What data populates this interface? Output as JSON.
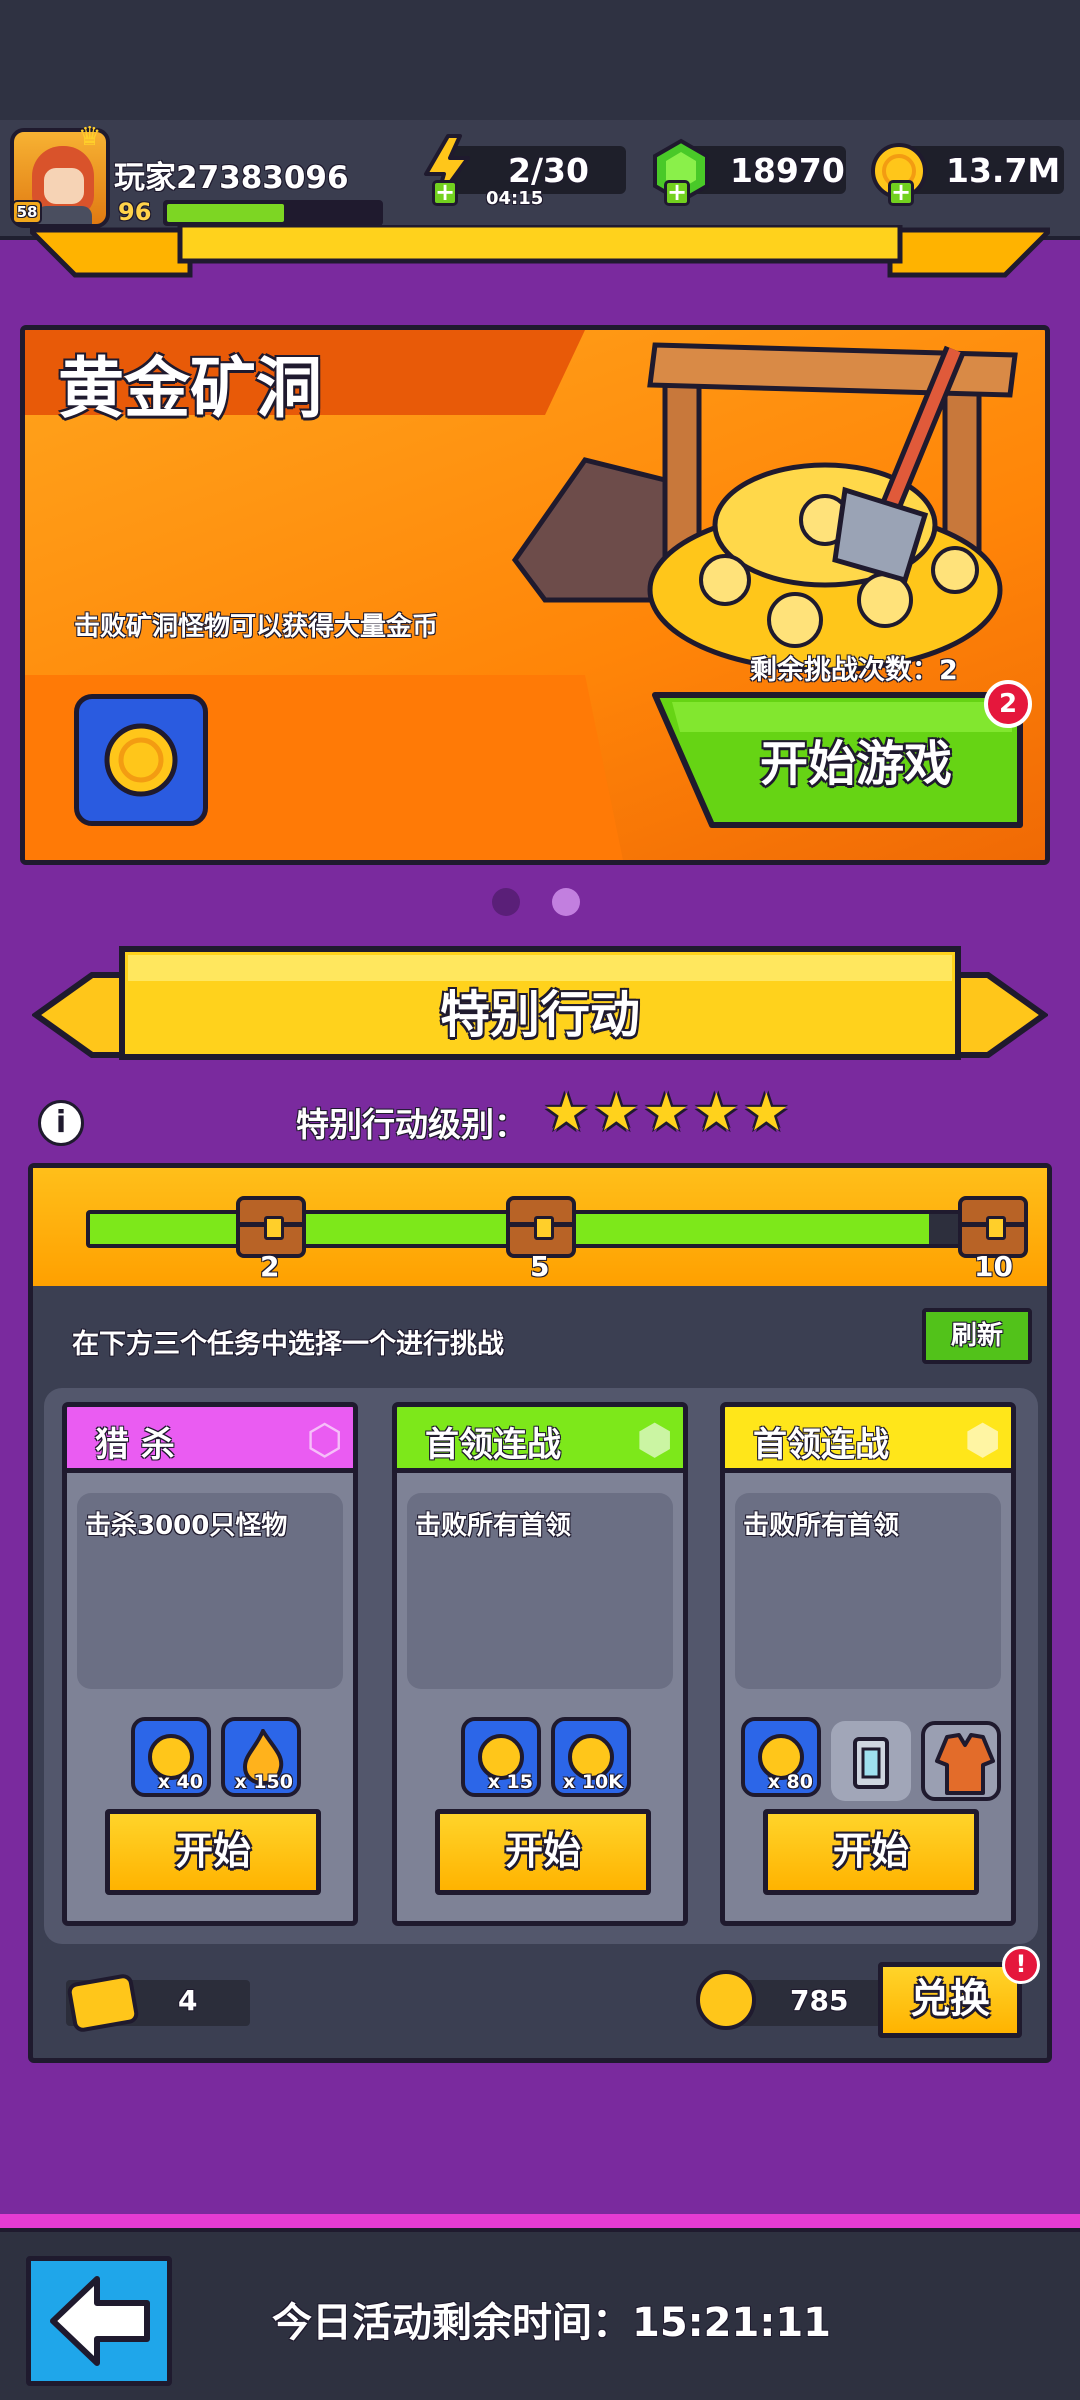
{
  "colors": {
    "background": "#7a2a9e",
    "accent_yellow": "#ffc61a",
    "accent_green": "#7de81a",
    "alert_red": "#e5173c"
  },
  "header": {
    "player_name": "玩家27383096",
    "player_level": "58",
    "xp_value": "96",
    "xp_progress_fraction": 0.55,
    "energy": "2/30",
    "energy_timer": "04:15",
    "gems": "18970",
    "gold": "13.7M"
  },
  "event": {
    "title": "黄金矿洞",
    "description": "击败矿洞怪物可以获得大量金币",
    "remaining_label": "剩余挑战次数：2",
    "start_button": "开始游戏",
    "badge_count": "2",
    "page_indicator": {
      "count": 2,
      "active_index": 1
    }
  },
  "special_action": {
    "title": "特别行动",
    "level_label": "特别行动级别：",
    "stars": 5,
    "progress_fraction": 0.9,
    "milestones": [
      "2",
      "5",
      "10"
    ],
    "task_instruction": "在下方三个任务中选择一个进行挑战",
    "refresh_button": "刷新",
    "cards": [
      {
        "title": "猎 杀",
        "head_color": "#ea5cf2",
        "description": "击杀3000只怪物",
        "rewards": [
          {
            "icon": "gold-token-icon",
            "qty": "x 40"
          },
          {
            "icon": "fire-orb-icon",
            "qty": "x 150"
          }
        ],
        "start_button": "开始"
      },
      {
        "title": "首领连战",
        "head_color": "#7de81a",
        "description": "击败所有首领",
        "rewards": [
          {
            "icon": "gold-token-icon",
            "qty": "x 15"
          },
          {
            "icon": "gold-coin-icon",
            "qty": "x 10K"
          }
        ],
        "start_button": "开始"
      },
      {
        "title": "首领连战",
        "head_color": "#ffe61a",
        "description": "击败所有首领",
        "rewards": [
          {
            "icon": "gold-token-icon",
            "qty": "x 80"
          },
          {
            "icon": "armor-piece-icon",
            "qty": ""
          },
          {
            "icon": "jacket-icon",
            "qty": ""
          }
        ],
        "start_button": "开始"
      }
    ],
    "ticket_count": "4",
    "token_count": "785",
    "exchange_button": "兑换",
    "exchange_alert": "!"
  },
  "footer": {
    "remaining_time": "今日活动剩余时间：15:21:11"
  }
}
